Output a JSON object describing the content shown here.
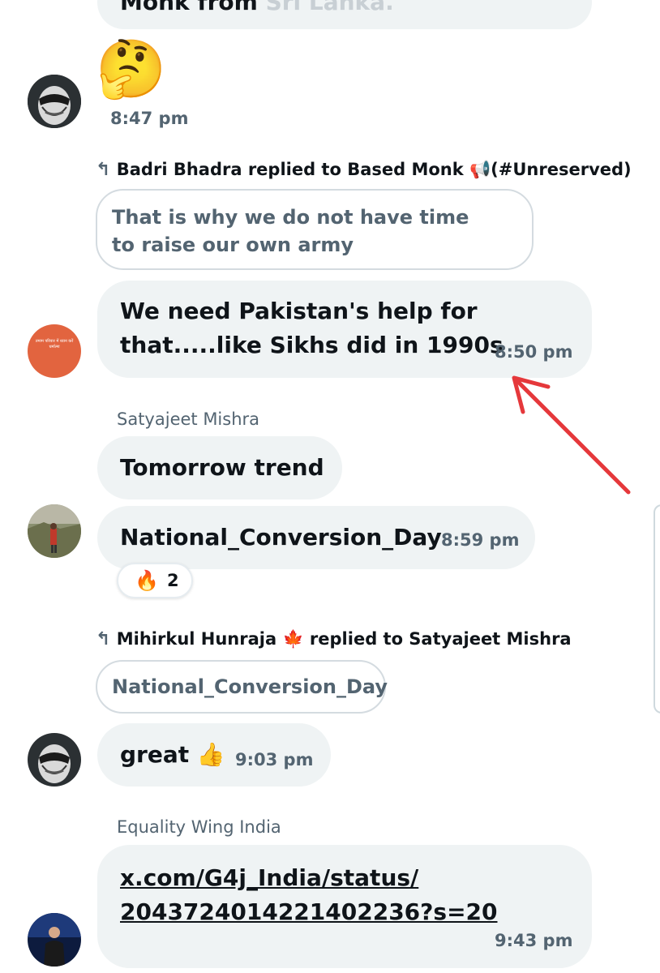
{
  "messages": {
    "top_partial": {
      "text_dark": "Monk from",
      "text_light": "Sri Lanka."
    },
    "emoji_msg": {
      "emoji": "🤔",
      "time": "8:47 pm"
    },
    "reply1": {
      "header": "Badri Bhadra replied to Based Monk 📢(#Unreserved)",
      "quoted": "That is why we do not have time to raise our own army",
      "line1": "We need Pakistan's help for",
      "line2": "that.....like Sikhs did in 1990s",
      "time": "8:50 pm"
    },
    "satyajeet": {
      "sender": "Satyajeet Mishra",
      "msg1": "Tomorrow trend",
      "msg2": "National_Conversion_Day",
      "time": "8:59 pm",
      "reaction_emoji": "🔥",
      "reaction_count": "2"
    },
    "reply2": {
      "header": "Mihirkul Hunraja 🍁 replied to Satyajeet Mishra",
      "quoted": "National_Conversion_Day",
      "text": "great 👍",
      "time": "9:03 pm"
    },
    "equality": {
      "sender": "Equality Wing India",
      "link_line1": "x.com/G4j_India/status/",
      "link_line2": "2043724014221402236?s=20",
      "time": "9:43 pm"
    }
  },
  "avatar_text": "तमाम परिवार में ध्यान करें धर्मात्मा",
  "colors": {
    "bubble": "#eff3f4",
    "annotation_arrow": "#e5383b",
    "secondary_text": "#536471"
  }
}
